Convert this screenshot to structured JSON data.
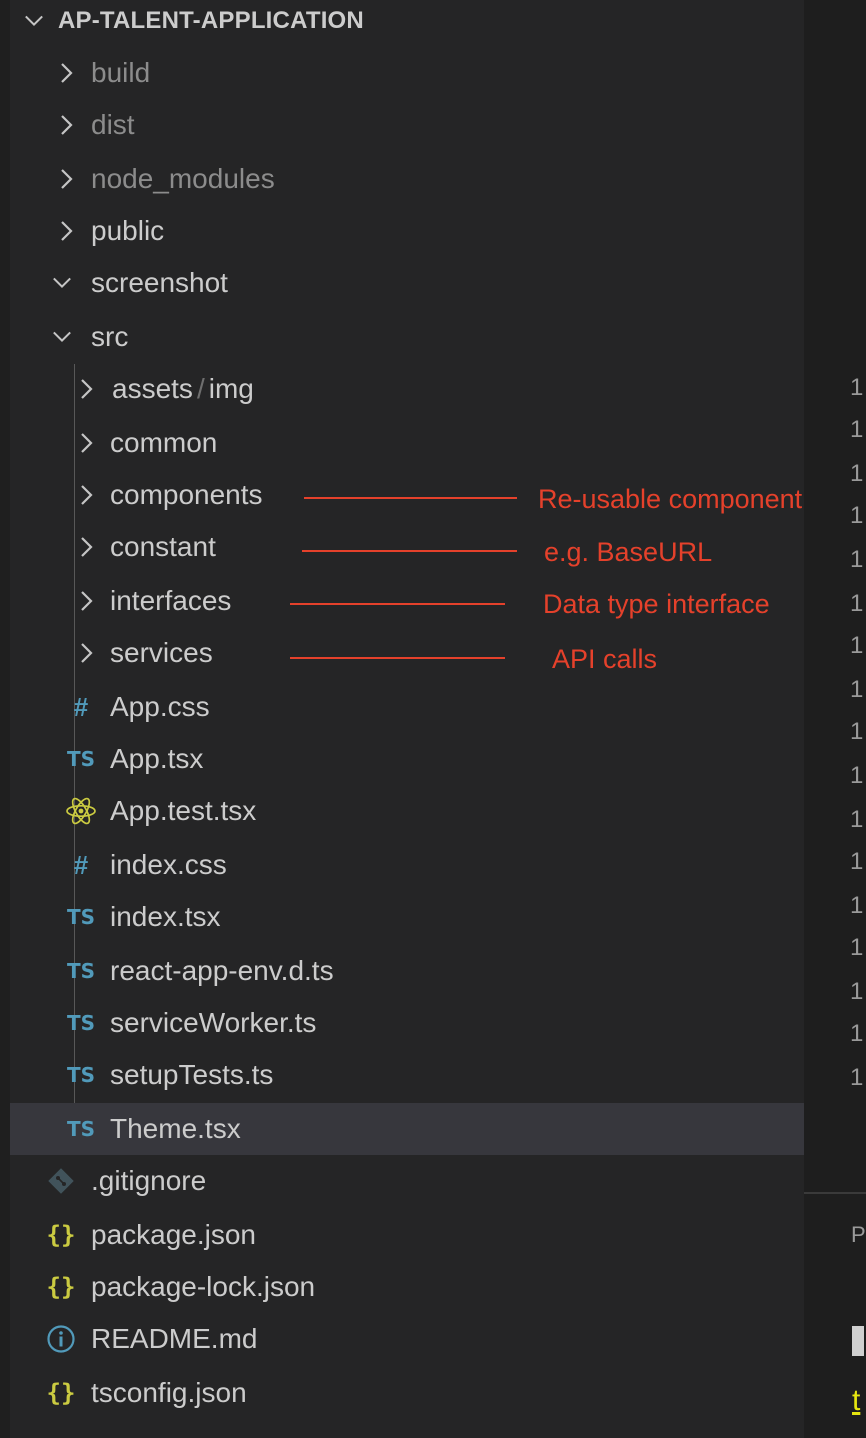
{
  "explorer": {
    "root": "AP-TALENT-APPLICATION",
    "items": [
      {
        "label": "build"
      },
      {
        "label": "dist"
      },
      {
        "label": "node_modules"
      },
      {
        "label": "public"
      },
      {
        "label": "screenshot"
      },
      {
        "label": "src"
      },
      {
        "label": "assets",
        "label2": "img",
        "separator": "/"
      },
      {
        "label": "common"
      },
      {
        "label": "components"
      },
      {
        "label": "constant"
      },
      {
        "label": "interfaces"
      },
      {
        "label": "services"
      },
      {
        "label": "App.css",
        "icon": "#"
      },
      {
        "label": "App.tsx",
        "icon": "TS"
      },
      {
        "label": "App.test.tsx"
      },
      {
        "label": "index.css",
        "icon": "#"
      },
      {
        "label": "index.tsx",
        "icon": "TS"
      },
      {
        "label": "react-app-env.d.ts",
        "icon": "TS"
      },
      {
        "label": "serviceWorker.ts",
        "icon": "TS"
      },
      {
        "label": "setupTests.ts",
        "icon": "TS"
      },
      {
        "label": "Theme.tsx",
        "icon": "TS"
      },
      {
        "label": ".gitignore"
      },
      {
        "label": "package.json",
        "icon": "{}"
      },
      {
        "label": "package-lock.json",
        "icon": "{}"
      },
      {
        "label": "README.md"
      },
      {
        "label": "tsconfig.json",
        "icon": "{}"
      }
    ]
  },
  "annotations": {
    "components": "Re-usable  component",
    "constant": "e.g. BaseURL",
    "interfaces": "Data type interface",
    "services": "API calls"
  },
  "editor": {
    "line_numbers": [
      "1",
      "1",
      "1",
      "1",
      "1",
      "1",
      "1",
      "1",
      "1",
      "1",
      "1",
      "1",
      "1",
      "1",
      "1",
      "1",
      "1"
    ],
    "panel_label": "P",
    "terminal_text": "t"
  },
  "colors": {
    "annotation": "#e5412b",
    "ts_icon": "#519aba",
    "json_icon": "#cbcb41",
    "react_icon": "#cbcb41",
    "git_icon": "#41535b",
    "info_icon": "#519aba"
  }
}
